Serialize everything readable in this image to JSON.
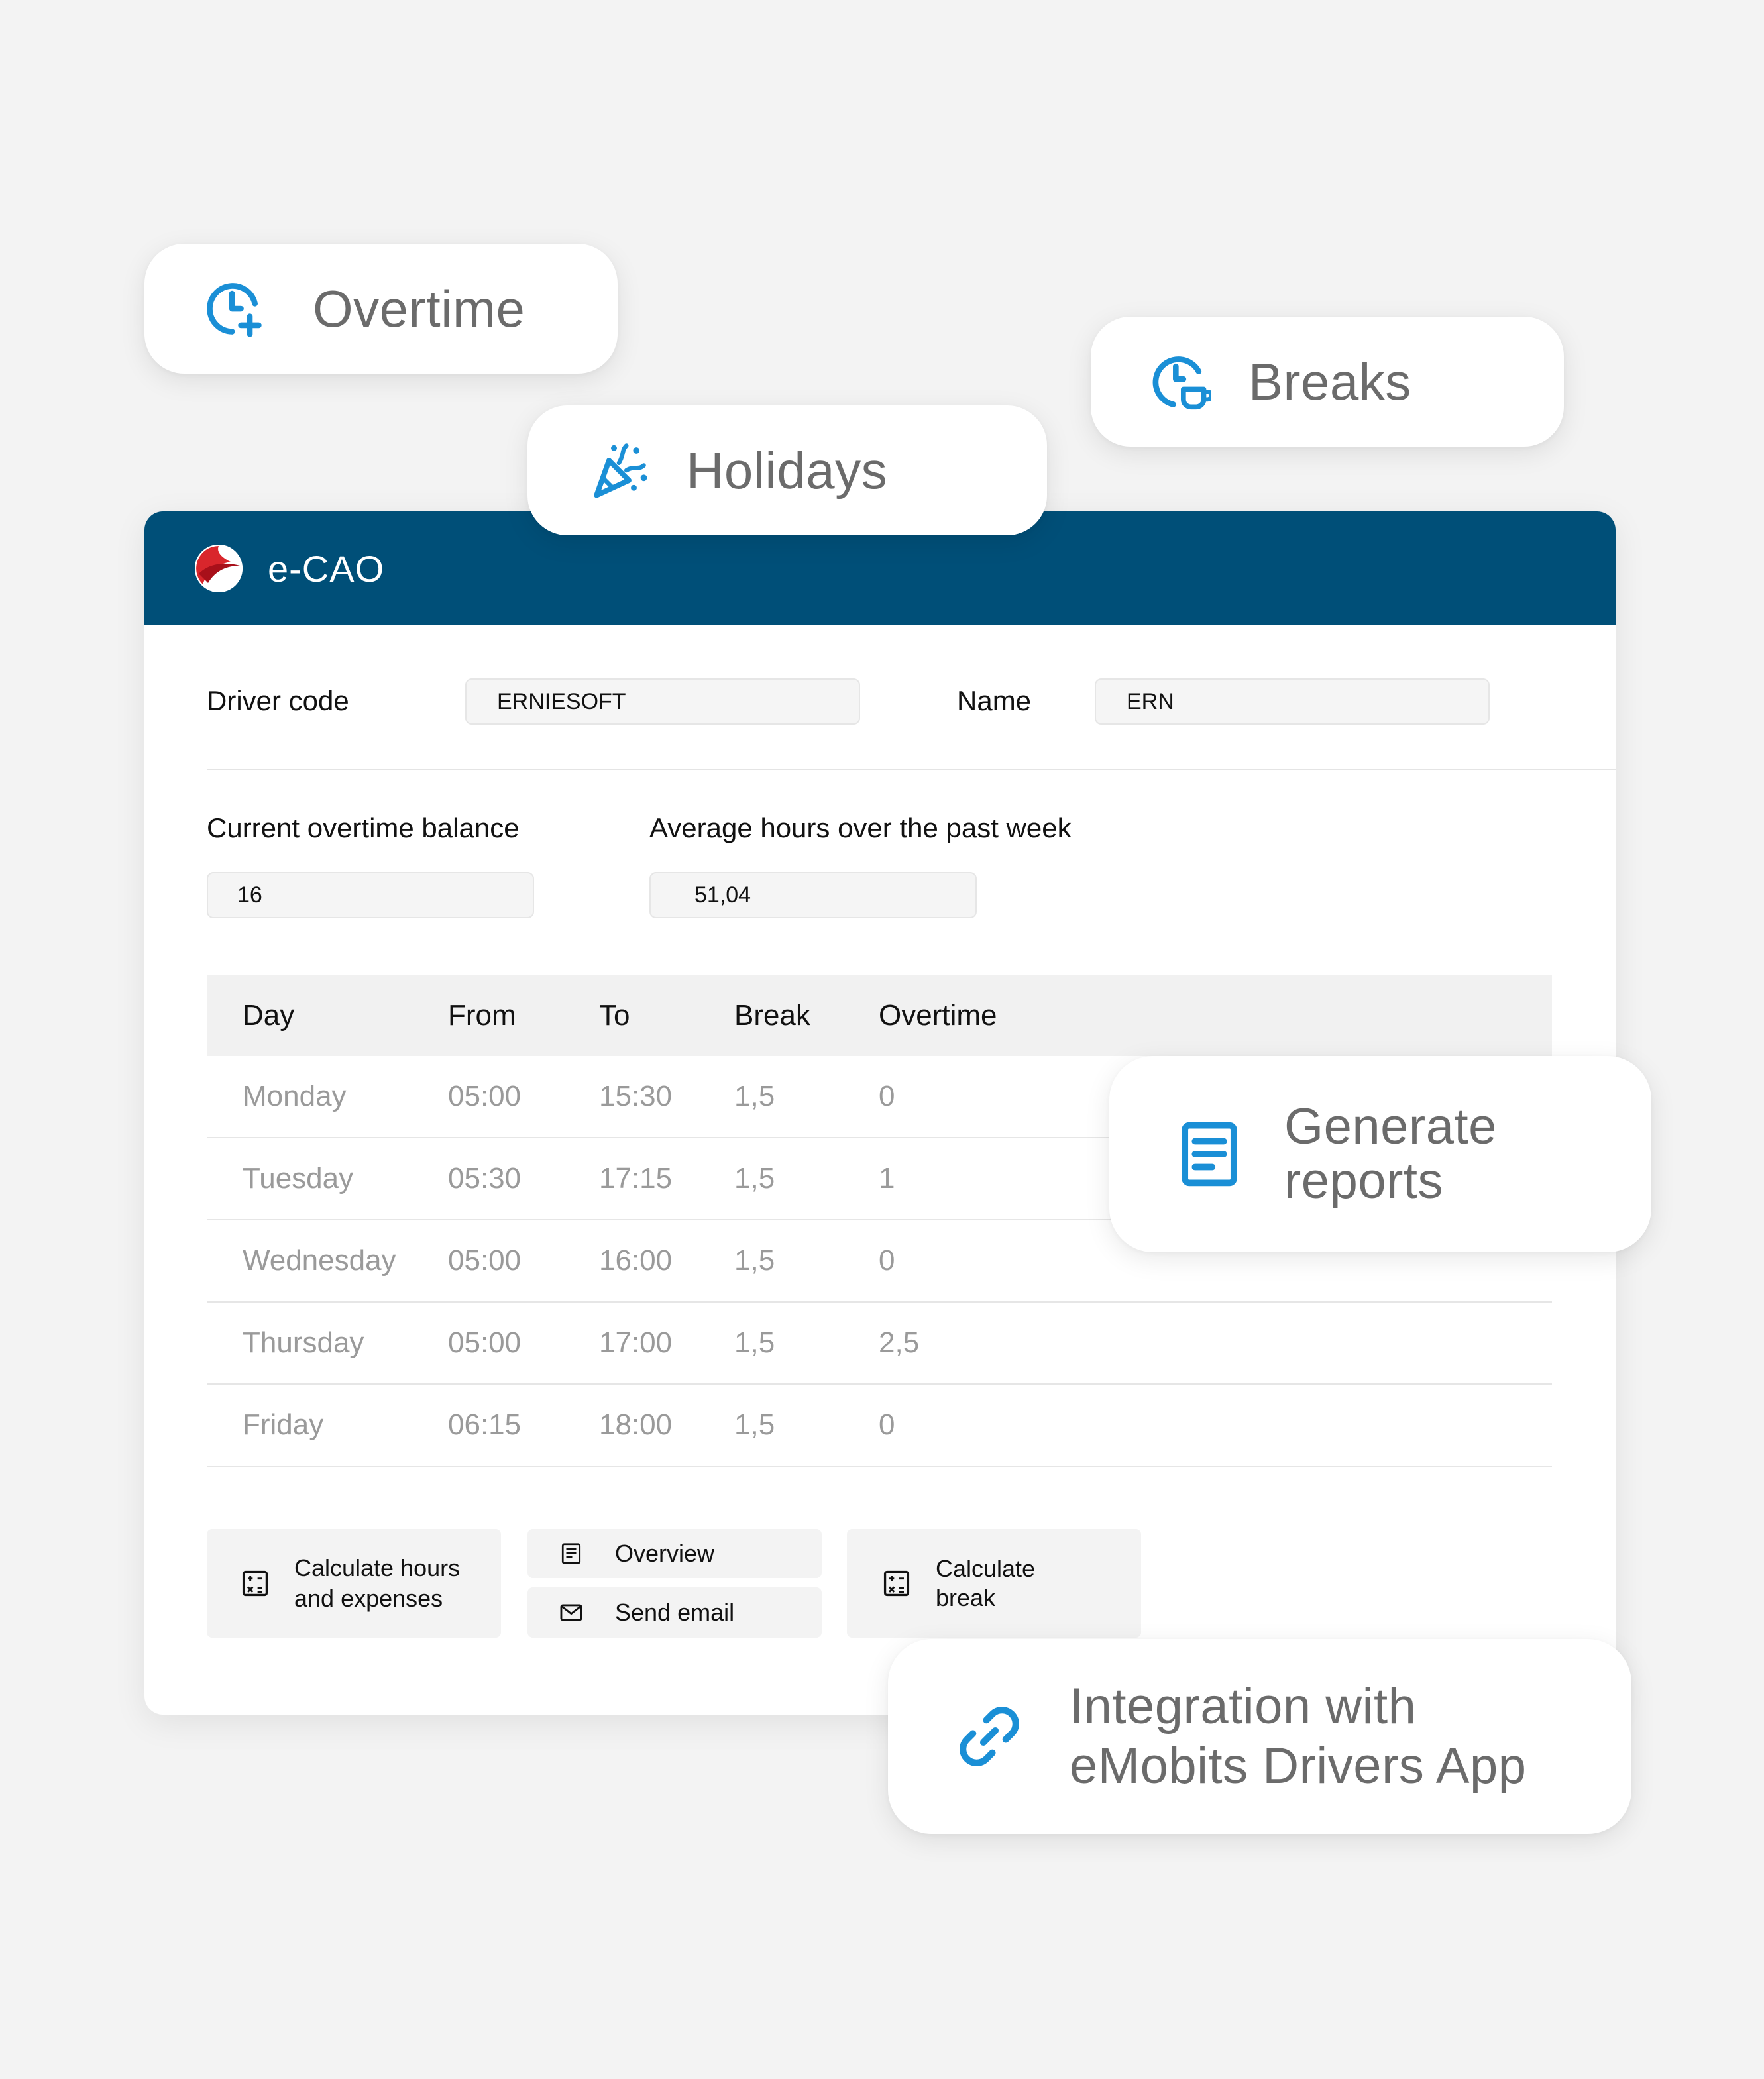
{
  "badges": {
    "overtime": "Overtime",
    "holidays": "Holidays",
    "breaks": "Breaks",
    "reports": "Generate reports",
    "integration": "Integration with eMobits Drivers App"
  },
  "window": {
    "title": "e-CAO",
    "driver_code_label": "Driver code",
    "driver_code_value": "ERNIESOFT",
    "name_label": "Name",
    "name_value": "ERN",
    "overtime_balance_label": "Current overtime balance",
    "overtime_balance_value": "16",
    "avg_hours_label": "Average hours over the past week",
    "avg_hours_value": "51,04"
  },
  "table": {
    "headers": [
      "Day",
      "From",
      "To",
      "Break",
      "Overtime"
    ],
    "rows": [
      [
        "Monday",
        "05:00",
        "15:30",
        "1,5",
        "0"
      ],
      [
        "Tuesday",
        "05:30",
        "17:15",
        "1,5",
        "1"
      ],
      [
        "Wednesday",
        "05:00",
        "16:00",
        "1,5",
        "0"
      ],
      [
        "Thursday",
        "05:00",
        "17:00",
        "1,5",
        "2,5"
      ],
      [
        "Friday",
        "06:15",
        "18:00",
        "1,5",
        "0"
      ]
    ]
  },
  "buttons": {
    "calc_hours": "Calculate hours and expenses",
    "overview": "Overview",
    "send_email": "Send email",
    "calc_break": "Calculate break"
  },
  "colors": {
    "titlebar": "#004f78",
    "accent_icon": "#1a8fd6",
    "logo_red": "#d9262c"
  },
  "icons": {
    "overtime": "clock-plus-icon",
    "holidays": "party-popper-icon",
    "breaks": "clock-cup-icon",
    "reports": "document-lines-icon",
    "integration": "link-icon",
    "calculator": "calculator-icon",
    "overview": "document-icon",
    "email": "envelope-icon"
  }
}
